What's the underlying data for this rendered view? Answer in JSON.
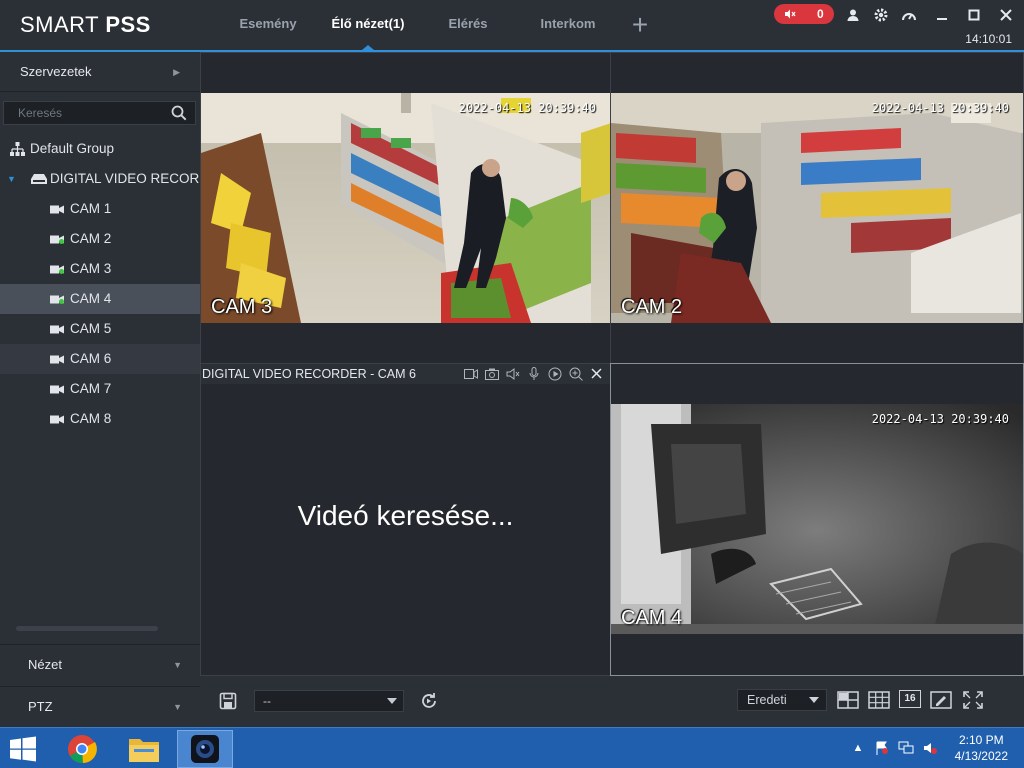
{
  "app": {
    "brand_light": "SMART ",
    "brand_bold": "PSS",
    "clock": "14:10:01"
  },
  "tabs": [
    {
      "label": "Esemény"
    },
    {
      "label": "Élő nézet(1)"
    },
    {
      "label": "Elérés"
    },
    {
      "label": "Interkom"
    }
  ],
  "alarm": {
    "count": "0"
  },
  "sidebar": {
    "org_label": "Szervezetek",
    "search_placeholder": "Keresés",
    "group": "Default Group",
    "device": "DIGITAL VIDEO RECORDER",
    "cameras": [
      {
        "label": "CAM 1",
        "online": false
      },
      {
        "label": "CAM 2",
        "online": true
      },
      {
        "label": "CAM 3",
        "online": true
      },
      {
        "label": "CAM 4",
        "online": true
      },
      {
        "label": "CAM 5",
        "online": false
      },
      {
        "label": "CAM 6",
        "online": false
      },
      {
        "label": "CAM 7",
        "online": false
      },
      {
        "label": "CAM 8",
        "online": false
      }
    ],
    "view_label": "Nézet",
    "ptz_label": "PTZ"
  },
  "views": {
    "cell1": {
      "cam": "CAM 3",
      "time": "2022-04-13 20:39:40"
    },
    "cell2": {
      "cam": "CAM 2",
      "time": "2022-04-13 20:39:40"
    },
    "cell3": {
      "title": "DIGITAL VIDEO RECORDER - CAM 6",
      "status": "Videó keresése..."
    },
    "cell4": {
      "cam": "CAM 4",
      "time": "2022-04-13 20:39:40"
    }
  },
  "toolbar": {
    "preset_value": "--",
    "ratio_value": "Eredeti",
    "layout16": "16"
  },
  "taskbar": {
    "time": "2:10 PM",
    "date": "4/13/2022"
  },
  "colors": {
    "accent": "#2f8fd8",
    "alarm": "#d9363e",
    "online": "#3ec83e"
  }
}
